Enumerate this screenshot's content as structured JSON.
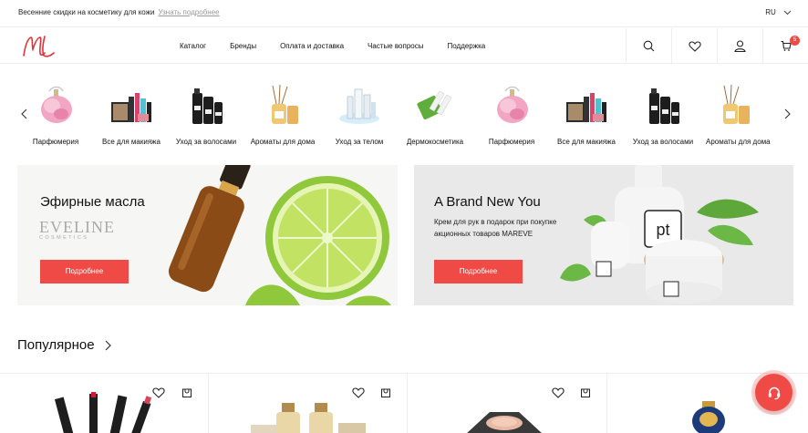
{
  "topbar": {
    "promo_text": "Весенние скидки на косметику для кожи",
    "promo_link": "Узнать подробнее",
    "language": "RU"
  },
  "header": {
    "nav": [
      "Каталог",
      "Бренды",
      "Оплата и доставка",
      "Частые вопросы",
      "Поддержка"
    ],
    "cart_count": "5",
    "icons": [
      "search-icon",
      "heart-icon",
      "user-icon",
      "cart-icon"
    ]
  },
  "categories": [
    "Парфюмерия",
    "Все для макияжа",
    "Уход за волосами",
    "Ароматы для дома",
    "Уход за телом",
    "Дермокосметика",
    "Парфюмерия",
    "Все для макияжа",
    "Уход за волосами",
    "Ароматы для дома"
  ],
  "banners": [
    {
      "title": "Эфирные масла",
      "brand_logo": [
        "EVELINE",
        "COSMETICS"
      ],
      "button": "Подробнее"
    },
    {
      "title": "A Brand New You",
      "text_lines": [
        "Крем для рук в подарок при покупке",
        "акционных товаров MAREVE"
      ],
      "button": "Подробнее",
      "product_mark": "pt"
    }
  ],
  "popular": {
    "title": "Популярное"
  },
  "colors": {
    "accent": "#f04a47",
    "border": "#eeeeee"
  }
}
